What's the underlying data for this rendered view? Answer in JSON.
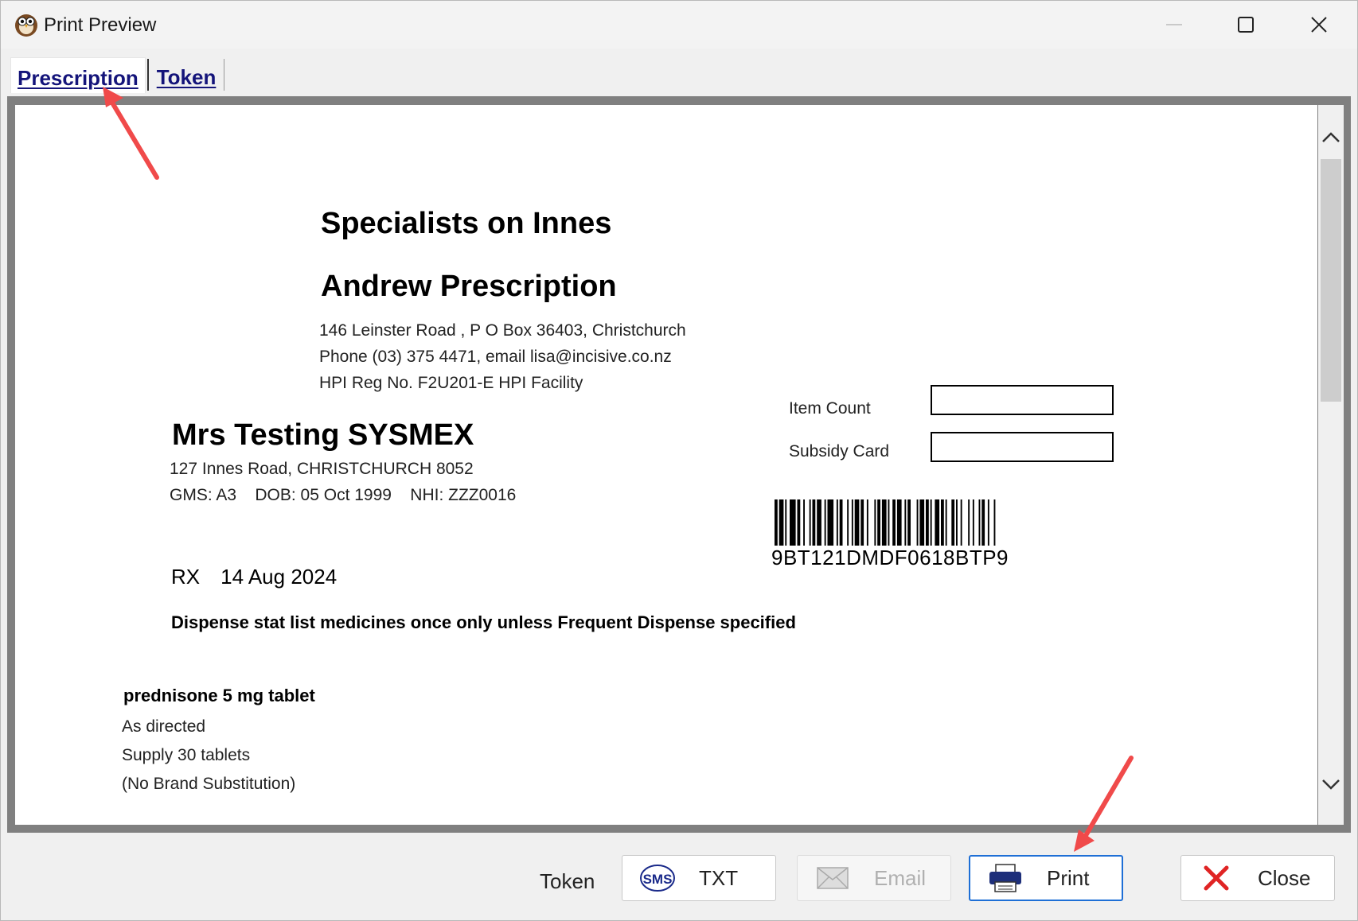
{
  "window": {
    "title": "Print Preview"
  },
  "tabs": [
    {
      "label": "Prescription",
      "active": true
    },
    {
      "label": "Token",
      "active": false
    }
  ],
  "document": {
    "practice_name": "Specialists on Innes",
    "doctor_name": "Andrew Prescription",
    "address_lines": [
      "146 Leinster Road , P O Box 36403, Christchurch",
      "Phone (03) 375 4471, email lisa@incisive.co.nz",
      "HPI Reg No. F2U201-E   HPI Facility"
    ],
    "fields": {
      "item_count_label": "Item Count",
      "subsidy_card_label": "Subsidy Card"
    },
    "barcode_text": "9BT121DMDF0618BTP9",
    "patient": {
      "name": "Mrs Testing SYSMEX",
      "address": "127 Innes Road, CHRISTCHURCH 8052",
      "details": "GMS: A3    DOB: 05 Oct 1999    NHI: ZZZ0016"
    },
    "rx_label": "RX",
    "rx_date": "14 Aug 2024",
    "dispense_note": "Dispense stat list medicines once only unless Frequent Dispense specified",
    "medication": {
      "name": "prednisone 5 mg tablet",
      "lines": [
        "As directed",
        "Supply 30 tablets",
        "(No Brand Substitution)"
      ]
    }
  },
  "footer": {
    "token_label": "Token",
    "buttons": {
      "txt": {
        "icon_text": "SMS",
        "label": "TXT"
      },
      "email": {
        "label": "Email",
        "enabled": false
      },
      "print": {
        "label": "Print"
      },
      "close": {
        "label": "Close"
      }
    }
  },
  "colors": {
    "tab_text": "#14147a",
    "annotation_arrow": "#f04a4a",
    "close_icon": "#e02424",
    "print_focus": "#1e6fd6",
    "sms_icon": "#1a2a8a"
  }
}
